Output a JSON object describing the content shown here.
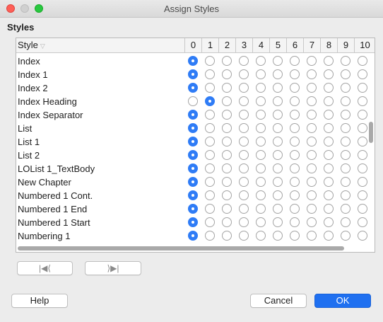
{
  "window": {
    "title": "Assign Styles"
  },
  "section": {
    "label": "Styles"
  },
  "table": {
    "style_header": "Style",
    "level_headers": [
      "0",
      "1",
      "2",
      "3",
      "4",
      "5",
      "6",
      "7",
      "8",
      "9",
      "10"
    ],
    "rows": [
      {
        "label": "Index",
        "selected_level": "0"
      },
      {
        "label": "Index 1",
        "selected_level": "0"
      },
      {
        "label": "Index 2",
        "selected_level": "0"
      },
      {
        "label": "Index Heading",
        "selected_level": "1"
      },
      {
        "label": "Index Separator",
        "selected_level": "0"
      },
      {
        "label": "List",
        "selected_level": "0"
      },
      {
        "label": "List 1",
        "selected_level": "0"
      },
      {
        "label": "List 2",
        "selected_level": "0"
      },
      {
        "label": "LOList 1_TextBody",
        "selected_level": "0"
      },
      {
        "label": "New Chapter",
        "selected_level": "0"
      },
      {
        "label": "Numbered 1 Cont.",
        "selected_level": "0"
      },
      {
        "label": "Numbered 1 End",
        "selected_level": "0"
      },
      {
        "label": "Numbered 1 Start",
        "selected_level": "0"
      },
      {
        "label": "Numbering 1",
        "selected_level": "0"
      }
    ]
  },
  "nav": {
    "prev_glyph": "|◀⟨",
    "next_glyph": "⟩▶|"
  },
  "buttons": {
    "help": "Help",
    "cancel": "Cancel",
    "ok": "OK"
  },
  "colors": {
    "accent": "#2f7cf6",
    "ok_button": "#1f70f0",
    "window_bg": "#ececec"
  }
}
